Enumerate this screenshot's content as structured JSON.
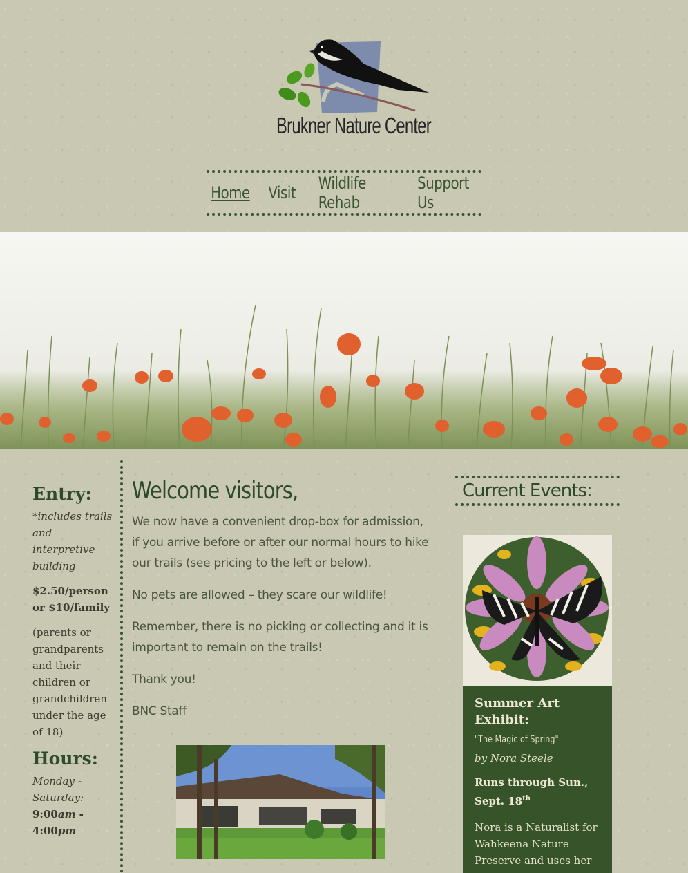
{
  "header": {
    "logo_text": "Brukner Nature Center"
  },
  "nav": {
    "items": [
      {
        "label": "Home"
      },
      {
        "label": "Visit"
      },
      {
        "label": "Wildlife Rehab"
      },
      {
        "label": "Support Us"
      }
    ],
    "active": "Home"
  },
  "sidebar": {
    "entry_heading": "Entry:",
    "entry_note": "*includes trails and interpretive building",
    "entry_price": "$2.50/person or $10/family",
    "entry_family_note": "(parents or grandparents and their children or grandchildren under the age of 18)",
    "hours_heading": "Hours:",
    "hours_days": "Monday - Saturday:",
    "hours_open": "9:00",
    "hours_open_suffix": "am",
    "hours_sep": " - ",
    "hours_close": "4:00",
    "hours_close_suffix": "pm"
  },
  "main": {
    "heading": "Welcome visitors,",
    "paragraphs": [
      "We now have a convenient drop-box for admission, if you arrive before or after our normal hours to hike our trails (see pricing to the left or below).",
      "No pets are allowed – they scare our wildlife!",
      "Remember, there is no picking or collecting and it is important to remain on the trails!",
      "Thank you!",
      "BNC Staff"
    ]
  },
  "events": {
    "title": "Current Events:",
    "card": {
      "title": "Summer Art Exhibit:",
      "subtitle": "\"The Magic of Spring\"",
      "byline": "by Nora Steele",
      "runs": "Runs through Sun., Sept. 18",
      "runs_sup": "th",
      "description": "Nora is a Naturalist for Wahkeena Nature Preserve and uses her"
    }
  },
  "colors": {
    "background": "#c9c8b3",
    "accent_green": "#365329",
    "heading_green": "#2f4a2a"
  }
}
